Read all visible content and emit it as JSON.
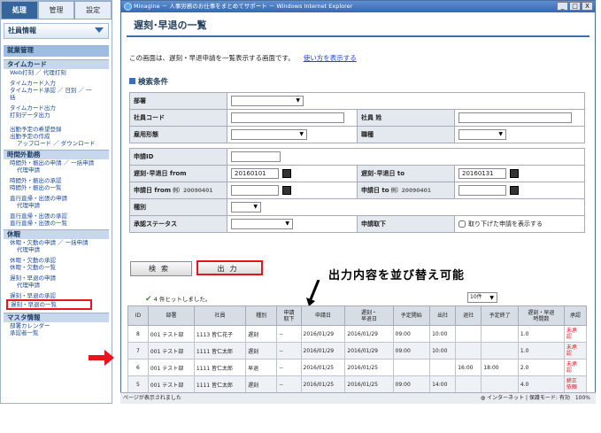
{
  "sidebar": {
    "tabs": [
      "処理",
      "管理",
      "設定"
    ],
    "dropdown": "社員情報",
    "section_main": "就業管理",
    "timecard_title": "タイムカード",
    "timecard_links": [
      "Web打刻 ／ 代理打刻",
      "タイムカード入力",
      "タイムカード承認 ／ 日別 ／ 一\n括",
      "タイムカード出力",
      "打刻データ出力"
    ],
    "schedule_links": [
      "出勤予定の希望登録",
      "出勤予定の作成"
    ],
    "schedule_sub": "アップロード ／ ダウンロード",
    "overtime_title": "時間外勤務",
    "overtime_links": [
      "時間外・振出の申請 ／ 一括申請"
    ],
    "overtime_sub": "代理申請",
    "overtime_links2": [
      "時間外・振出の承認",
      "時間外・振出の一覧"
    ],
    "travel_links": [
      "直行直帰・出張の申請"
    ],
    "travel_sub": "代理申請",
    "travel_links2": [
      "直行直帰・出張の承認",
      "直行直帰・出張の一覧"
    ],
    "leave_title": "休暇",
    "leave_links": [
      "休暇・欠勤の申請 ／ 一括申請"
    ],
    "leave_sub": "代理申請",
    "leave_links2": [
      "休暇・欠勤の承認",
      "休暇・欠勤の一覧"
    ],
    "late_links": [
      "遅刻・早退の申請"
    ],
    "late_sub": "代理申請",
    "late_links2": [
      "遅刻・早退の承認",
      "遅刻・早退の一覧"
    ],
    "master_title": "マスタ情報",
    "master_links": [
      "部署カレンダー",
      "承認者一覧"
    ]
  },
  "window": {
    "title": "Minagine － 人事労務のお仕事をまとめてサポート － Windows Internet Explorer",
    "controls": [
      "_",
      "□",
      "X"
    ]
  },
  "page": {
    "title": "遅刻･早退の一覧",
    "description": "この画面は、遅刻・早退申請を一覧表示する画面です。",
    "howto": "使い方を表示する",
    "criteria_title": "検索条件"
  },
  "form": {
    "dept": "部署",
    "emp_code": "社員コード",
    "emp_name": "社員 姓",
    "emp_type": "雇用形態",
    "job": "職種",
    "apply_id": "申請ID",
    "late_from": "遅刻･早退日 from",
    "late_from_val": "20160101",
    "late_to": "遅刻･早退日 to",
    "late_to_val": "20160131",
    "apply_from": "申請日 from",
    "apply_from_hint": "例）20090401",
    "apply_to": "申請日 to",
    "apply_to_hint": "例）20090401",
    "kind": "種別",
    "status": "承認ステータス",
    "withdraw": "申請取下",
    "withdraw_check": "取り下げた申請を表示する"
  },
  "buttons": {
    "search": "検索",
    "output": "出力"
  },
  "callout": "出力内容を並び替え可能",
  "hits": "4 件ヒットしました。",
  "per_page": "10件",
  "table": {
    "headers": [
      "ID",
      "部署",
      "社員",
      "種別",
      "申請\n取下",
      "申請日",
      "遅刻・\n早退日",
      "予定開始",
      "出社",
      "退社",
      "予定終了",
      "遅刻・早退\n時間数",
      "承認"
    ],
    "rows": [
      [
        "8",
        "001 テスト部",
        "1113 皆仁花子",
        "遅刻",
        "--",
        "2016/01/29",
        "2016/01/29",
        "09:00",
        "10:00",
        "",
        "",
        "1.0",
        "未承\n認"
      ],
      [
        "7",
        "001 テスト部",
        "1111 皆仁太郎",
        "遅刻",
        "--",
        "2016/01/29",
        "2016/01/29",
        "09:00",
        "10:00",
        "",
        "",
        "1.0",
        "未承\n認"
      ],
      [
        "6",
        "001 テスト部",
        "1111 皆仁太郎",
        "早退",
        "--",
        "2016/01/25",
        "2016/01/25",
        "",
        "",
        "16:00",
        "18:00",
        "2.0",
        "未承\n認"
      ],
      [
        "5",
        "001 テスト部",
        "1111 皆仁太郎",
        "遅刻",
        "--",
        "2016/01/25",
        "2016/01/25",
        "09:00",
        "14:00",
        "",
        "",
        "4.0",
        "締正\n依頼"
      ]
    ]
  },
  "status_bar": {
    "left": "ページが表示されました",
    "zone": "インターネット | 保護モード: 有効",
    "zoom": "100%"
  }
}
